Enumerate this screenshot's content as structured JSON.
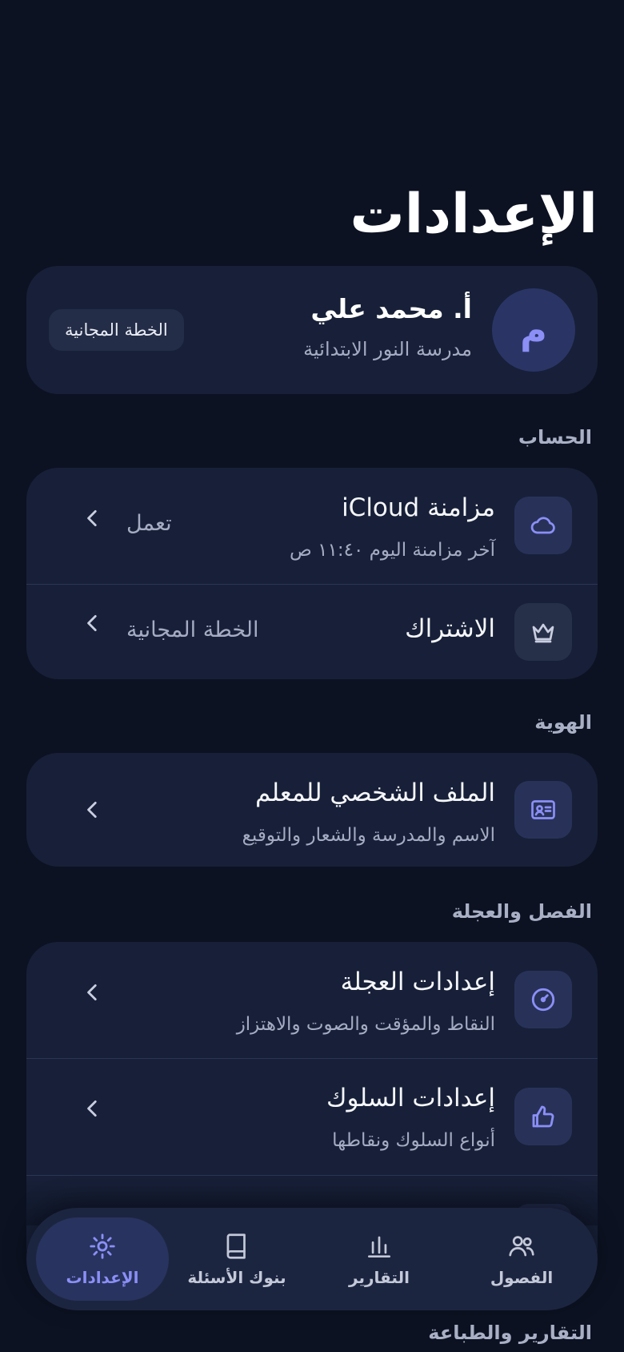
{
  "page": {
    "title": "الإعدادات"
  },
  "profile": {
    "avatar_letter": "م",
    "name": "أ. محمد علي",
    "school": "مدرسة النور الابتدائية",
    "plan_badge": "الخطة المجانية"
  },
  "sections": {
    "account": {
      "label": "الحساب",
      "icloud": {
        "title": "مزامنة iCloud",
        "subtitle": "آخر مزامنة اليوم ١١:٤٠ ص",
        "value": "تعمل",
        "icon": "cloud-icon"
      },
      "subscription": {
        "title": "الاشتراك",
        "value": "الخطة المجانية",
        "icon": "crown-icon"
      }
    },
    "identity": {
      "label": "الهوية",
      "teacher_profile": {
        "title": "الملف الشخصي للمعلم",
        "subtitle": "الاسم والمدرسة والشعار والتوقيع",
        "icon": "id-card-icon"
      }
    },
    "class_wheel": {
      "label": "الفصل والعجلة",
      "wheel_settings": {
        "title": "إعدادات العجلة",
        "subtitle": "النقاط والمؤقت والصوت والاهتزاز",
        "icon": "gauge-icon"
      },
      "behavior_settings": {
        "title": "إعدادات السلوك",
        "subtitle": "أنواع السلوك ونقاطها",
        "icon": "thumbs-up-icon"
      }
    },
    "reports_printing": {
      "label": "التقارير والطباعة"
    }
  },
  "tabbar": {
    "classes": "الفصول",
    "reports": "التقارير",
    "question_banks": "بنوك الأسئلة",
    "settings": "الإعدادات",
    "active": "settings"
  },
  "colors": {
    "background": "#0c1222",
    "card": "#172038",
    "accent": "#8b8ff6"
  }
}
